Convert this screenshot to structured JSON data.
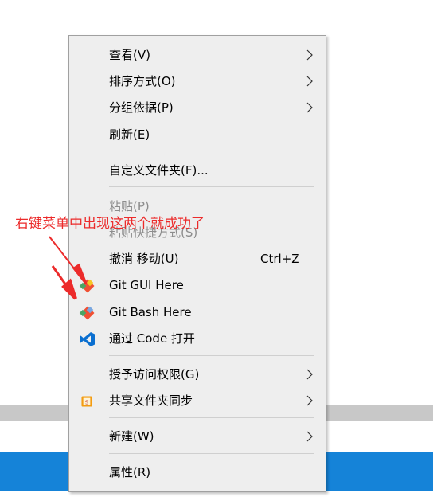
{
  "menu": {
    "items": [
      {
        "label": "查看(V)",
        "submenu": true
      },
      {
        "label": "排序方式(O)",
        "submenu": true
      },
      {
        "label": "分组依据(P)",
        "submenu": true
      },
      {
        "label": "刷新(E)"
      },
      {
        "label": "自定义文件夹(F)..."
      },
      {
        "label": "粘贴(P)",
        "disabled": true
      },
      {
        "label": "粘贴快捷方式(S)",
        "disabled": true
      },
      {
        "label": "撤消 移动(U)",
        "shortcut": "Ctrl+Z"
      },
      {
        "label": "Git GUI Here",
        "icon": "git-icon"
      },
      {
        "label": "Git Bash Here",
        "icon": "git-icon"
      },
      {
        "label": "通过 Code 打开",
        "icon": "vscode-icon"
      },
      {
        "label": "授予访问权限(G)",
        "submenu": true
      },
      {
        "label": "共享文件夹同步",
        "submenu": true,
        "icon": "sync-icon"
      },
      {
        "label": "新建(W)",
        "submenu": true
      },
      {
        "label": "属性(R)"
      }
    ]
  },
  "annotation": {
    "text": "右键菜单中出现这两个就成功了",
    "color": "#ec2b2b"
  },
  "colors": {
    "menu_background": "#eeeeee",
    "disabled_text": "#8c8c8c",
    "taskbar_blue": "#1583d8",
    "vscode_blue": "#0a6fd0",
    "git_orange": "#f05033"
  }
}
